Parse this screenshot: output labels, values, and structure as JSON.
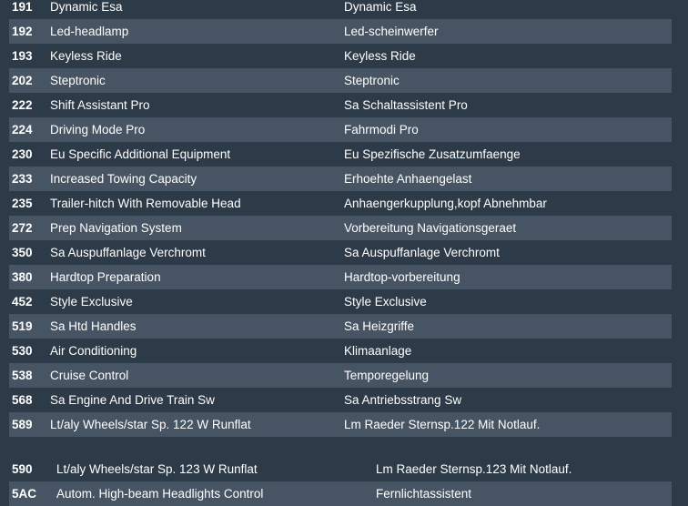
{
  "colors": {
    "background": "#2d3a47",
    "striped_row": "#465463",
    "text": "#ffffff"
  },
  "options_table": {
    "rows": [
      {
        "code": "191",
        "description_en": "Dynamic Esa",
        "description_de": "Dynamic Esa"
      },
      {
        "code": "192",
        "description_en": "Led-headlamp",
        "description_de": "Led-scheinwerfer"
      },
      {
        "code": "193",
        "description_en": "Keyless Ride",
        "description_de": "Keyless Ride"
      },
      {
        "code": "202",
        "description_en": "Steptronic",
        "description_de": "Steptronic"
      },
      {
        "code": "222",
        "description_en": "Shift Assistant Pro",
        "description_de": "Sa Schaltassistent Pro"
      },
      {
        "code": "224",
        "description_en": "Driving Mode Pro",
        "description_de": "Fahrmodi Pro"
      },
      {
        "code": "230",
        "description_en": "Eu Specific Additional Equipment",
        "description_de": "Eu Spezifische Zusatzumfaenge"
      },
      {
        "code": "233",
        "description_en": "Increased Towing Capacity",
        "description_de": "Erhoehte Anhaengelast"
      },
      {
        "code": "235",
        "description_en": "Trailer-hitch With Removable Head",
        "description_de": "Anhaengerkupplung,kopf Abnehmbar"
      },
      {
        "code": "272",
        "description_en": "Prep Navigation System",
        "description_de": "Vorbereitung Navigationsgeraet"
      },
      {
        "code": "350",
        "description_en": "Sa Auspuffanlage Verchromt",
        "description_de": "Sa Auspuffanlage Verchromt"
      },
      {
        "code": "380",
        "description_en": "Hardtop Preparation",
        "description_de": "Hardtop-vorbereitung"
      },
      {
        "code": "452",
        "description_en": "Style Exclusive",
        "description_de": "Style Exclusive"
      },
      {
        "code": "519",
        "description_en": "Sa Htd Handles",
        "description_de": "Sa Heizgriffe"
      },
      {
        "code": "530",
        "description_en": "Air Conditioning",
        "description_de": "Klimaanlage"
      },
      {
        "code": "538",
        "description_en": "Cruise Control",
        "description_de": "Temporegelung"
      },
      {
        "code": "568",
        "description_en": "Sa Engine And Drive Train Sw",
        "description_de": "Sa Antriebsstrang Sw"
      },
      {
        "code": "589",
        "description_en": "Lt/aly Wheels/star Sp. 122 W Runflat",
        "description_de": "Lm Raeder Sternsp.122 Mit Notlauf."
      }
    ]
  },
  "options_table_2": {
    "rows": [
      {
        "code": "590",
        "description_en": "Lt/aly Wheels/star Sp. 123 W Runflat",
        "description_de": "Lm Raeder Sternsp.123 Mit Notlauf."
      },
      {
        "code": "5AC",
        "description_en": "Autom. High-beam Headlights Control",
        "description_de": "Fernlichtassistent"
      }
    ]
  }
}
